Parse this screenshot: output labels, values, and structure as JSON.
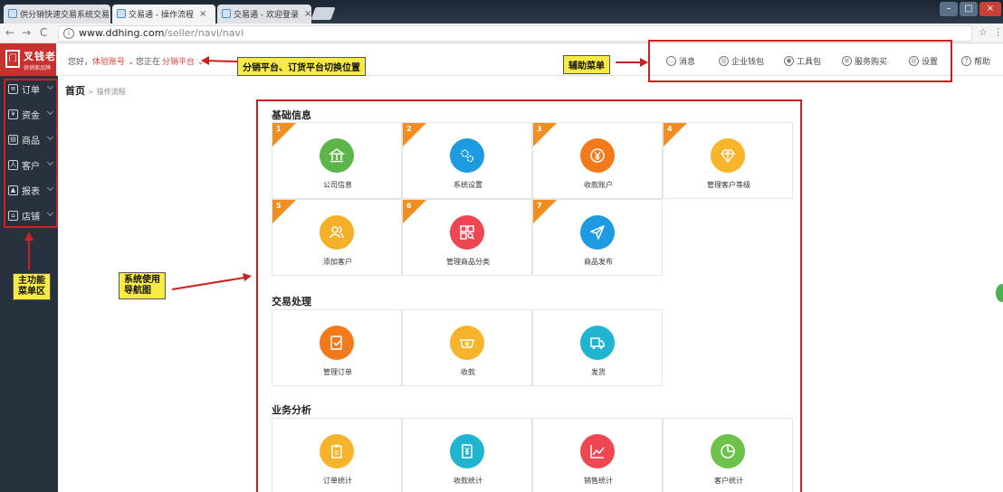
{
  "browser": {
    "tabs": [
      {
        "label": "供分销快速交易系统交易"
      },
      {
        "label": "交易通 - 操作流程"
      },
      {
        "label": "交易通 - 欢迎登录"
      }
    ],
    "close_glyph": "×",
    "url_domain": "www.ddhing.com",
    "url_path": "/seller/navi/navi"
  },
  "header": {
    "logo_name": "叉钱老",
    "logo_sub": "供销家品牌",
    "greeting": "您好，",
    "account": "体验账号",
    "at_label": "您正在",
    "platform": "分销平台",
    "aux_menu": [
      {
        "label": "消息",
        "icon": "message-icon"
      },
      {
        "label": "企业钱包",
        "icon": "wallet-icon"
      },
      {
        "label": "工具包",
        "icon": "toolbox-icon"
      },
      {
        "label": "服务购买",
        "icon": "service-icon"
      },
      {
        "label": "设置",
        "icon": "settings-icon"
      },
      {
        "label": "帮助",
        "icon": "help-icon"
      }
    ]
  },
  "sidebar": {
    "items": [
      {
        "label": "订单",
        "icon": "order-icon"
      },
      {
        "label": "资金",
        "icon": "funds-icon"
      },
      {
        "label": "商品",
        "icon": "goods-icon"
      },
      {
        "label": "客户",
        "icon": "customer-icon"
      },
      {
        "label": "报表",
        "icon": "report-icon"
      },
      {
        "label": "店铺",
        "icon": "shop-icon"
      }
    ]
  },
  "breadcrumb": {
    "home": "首页",
    "sep": ">",
    "current": "操作流程"
  },
  "sections": [
    {
      "title": "基础信息",
      "items": [
        {
          "label": "公司信息",
          "num": "1",
          "color": "#5bb548",
          "icon": "bank-icon"
        },
        {
          "label": "系统设置",
          "num": "2",
          "color": "#1e9be0",
          "icon": "gears-icon"
        },
        {
          "label": "收款账户",
          "num": "3",
          "color": "#f27a1a",
          "icon": "yen-icon"
        },
        {
          "label": "管理客户等级",
          "num": "4",
          "color": "#f7b52b",
          "icon": "diamond-icon"
        },
        {
          "label": "添加客户",
          "num": "5",
          "color": "#f5b02a",
          "icon": "users-icon"
        },
        {
          "label": "管理商品分类",
          "num": "6",
          "color": "#ee4751",
          "icon": "category-icon"
        },
        {
          "label": "商品发布",
          "num": "7",
          "color": "#1e9be0",
          "icon": "send-icon"
        }
      ]
    },
    {
      "title": "交易处理",
      "items": [
        {
          "label": "管理订单",
          "num": "",
          "color": "#f27a1a",
          "icon": "order-manage-icon"
        },
        {
          "label": "收款",
          "num": "",
          "color": "#f6b42c",
          "icon": "receive-icon"
        },
        {
          "label": "发货",
          "num": "",
          "color": "#1fb4cf",
          "icon": "truck-icon"
        }
      ]
    },
    {
      "title": "业务分析",
      "items": [
        {
          "label": "订单统计",
          "num": "",
          "color": "#f6b42c",
          "icon": "clipboard-icon"
        },
        {
          "label": "收款统计",
          "num": "",
          "color": "#1fb4cf",
          "icon": "yen-doc-icon"
        },
        {
          "label": "销售统计",
          "num": "",
          "color": "#ee4751",
          "icon": "line-chart-icon"
        },
        {
          "label": "客户统计",
          "num": "",
          "color": "#6cc24a",
          "icon": "pie-icon"
        }
      ]
    }
  ],
  "annotations": {
    "platform_switch": "分销平台、订货平台切换位置",
    "aux_menu": "辅助菜单",
    "main_menu_l1": "主功能",
    "main_menu_l2": "菜单区",
    "nav_map_l1": "系统使用",
    "nav_map_l2": "导航图"
  },
  "colors": {
    "sidebar_bg": "#28323e",
    "accent_red": "#d9443a",
    "logo_bg": "#c8312e",
    "annotation_red": "#cc1f1f",
    "note_yellow": "#f8eb44"
  }
}
